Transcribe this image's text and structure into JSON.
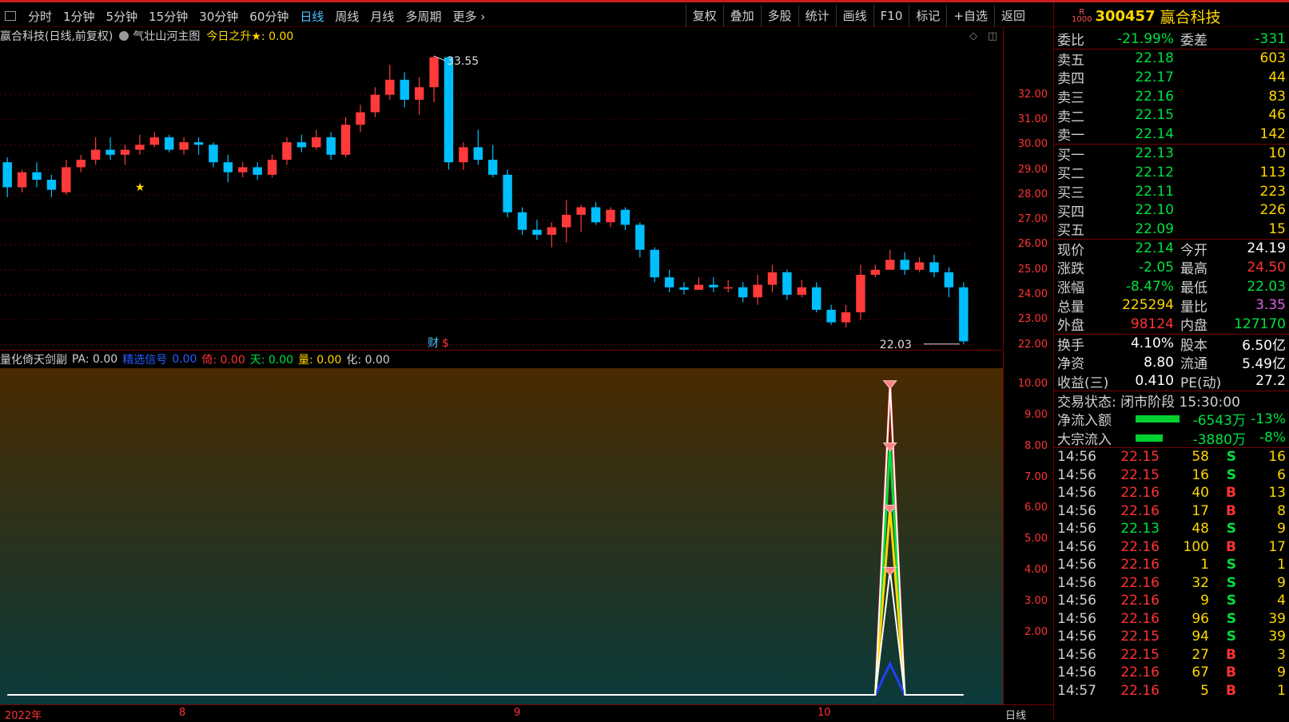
{
  "toolbar": {
    "periods": [
      "分时",
      "1分钟",
      "5分钟",
      "15分钟",
      "30分钟",
      "60分钟",
      "日线",
      "周线",
      "月线",
      "多周期",
      "更多 ›"
    ],
    "active": "日线",
    "tools": [
      "复权",
      "叠加",
      "多股",
      "统计",
      "画线",
      "F10",
      "标记",
      "+自选",
      "返回"
    ]
  },
  "stock": {
    "badge_top": "R",
    "badge_bottom": "1000",
    "code": "300457",
    "name": "赢合科技"
  },
  "main_chart": {
    "title_stock": "赢合科技(日线,前复权)",
    "indicator_name": "气壮山河主图",
    "indicator_value": "今日之升★: 0.00",
    "high_label": "33.55",
    "low_label": "22.03",
    "cai_label": "财",
    "dollar_label": "$",
    "y_ticks": [
      "32.00",
      "31.00",
      "30.00",
      "29.00",
      "28.00",
      "27.00",
      "26.00",
      "25.00",
      "24.00",
      "23.00",
      "22.00"
    ]
  },
  "sub_chart": {
    "name": "量化倚天剑副",
    "pa": "PA: 0.00",
    "sig_label": "精选信号",
    "sig_val": "0.00",
    "yi": "倚: 0.00",
    "tian": "天: 0.00",
    "liang": "量: 0.00",
    "hua": "化: 0.00",
    "y_ticks": [
      "10.00",
      "9.00",
      "8.00",
      "7.00",
      "6.00",
      "5.00",
      "4.00",
      "3.00",
      "2.00"
    ]
  },
  "x_axis": {
    "year": "2022年",
    "m8": "8",
    "m9": "9",
    "m10": "10",
    "period": "日线"
  },
  "quote": {
    "weibi": {
      "label": "委比",
      "value": "-21.99%",
      "label2": "委差",
      "value2": "-331"
    },
    "asks": [
      {
        "label": "卖五",
        "price": "22.18",
        "vol": "603"
      },
      {
        "label": "卖四",
        "price": "22.17",
        "vol": "44"
      },
      {
        "label": "卖三",
        "price": "22.16",
        "vol": "83"
      },
      {
        "label": "卖二",
        "price": "22.15",
        "vol": "46"
      },
      {
        "label": "卖一",
        "price": "22.14",
        "vol": "142"
      }
    ],
    "bids": [
      {
        "label": "买一",
        "price": "22.13",
        "vol": "10"
      },
      {
        "label": "买二",
        "price": "22.12",
        "vol": "113"
      },
      {
        "label": "买三",
        "price": "22.11",
        "vol": "223"
      },
      {
        "label": "买四",
        "price": "22.10",
        "vol": "226"
      },
      {
        "label": "买五",
        "price": "22.09",
        "vol": "15"
      }
    ],
    "stats": [
      {
        "l1": "现价",
        "v1": "22.14",
        "c1": "grn",
        "l2": "今开",
        "v2": "24.19",
        "c2": "wht"
      },
      {
        "l1": "涨跌",
        "v1": "-2.05",
        "c1": "grn",
        "l2": "最高",
        "v2": "24.50",
        "c2": "red"
      },
      {
        "l1": "涨幅",
        "v1": "-8.47%",
        "c1": "grn",
        "l2": "最低",
        "v2": "22.03",
        "c2": "grn"
      },
      {
        "l1": "总量",
        "v1": "225294",
        "c1": "yel",
        "l2": "量比",
        "v2": "3.35",
        "c2": "mag"
      },
      {
        "l1": "外盘",
        "v1": "98124",
        "c1": "red",
        "l2": "内盘",
        "v2": "127170",
        "c2": "grn"
      }
    ],
    "stats2": [
      {
        "l1": "换手",
        "v1": "4.10%",
        "l2": "股本",
        "v2": "6.50亿"
      },
      {
        "l1": "净资",
        "v1": "8.80",
        "l2": "流通",
        "v2": "5.49亿"
      },
      {
        "l1": "收益(三)",
        "v1": "0.410",
        "l2": "PE(动)",
        "v2": "27.2"
      }
    ],
    "trade_status": "交易状态: 闭市阶段 15:30:00",
    "net_inflow": {
      "label": "净流入额",
      "value": "-6543万",
      "pct": "-13%",
      "bar": 0.13
    },
    "block_inflow": {
      "label": "大宗流入",
      "value": "-3880万",
      "pct": "-8%",
      "bar": 0.08
    }
  },
  "ticks": [
    {
      "t": "14:56",
      "p": "22.15",
      "v": "58",
      "bs": "S",
      "n": "16"
    },
    {
      "t": "14:56",
      "p": "22.15",
      "v": "16",
      "bs": "S",
      "n": "6"
    },
    {
      "t": "14:56",
      "p": "22.16",
      "v": "40",
      "bs": "B",
      "n": "13"
    },
    {
      "t": "14:56",
      "p": "22.16",
      "v": "17",
      "bs": "B",
      "n": "8"
    },
    {
      "t": "14:56",
      "p": "22.13",
      "v": "48",
      "bs": "S",
      "n": "9"
    },
    {
      "t": "14:56",
      "p": "22.16",
      "v": "100",
      "bs": "B",
      "n": "17"
    },
    {
      "t": "14:56",
      "p": "22.16",
      "v": "1",
      "bs": "S",
      "n": "1"
    },
    {
      "t": "14:56",
      "p": "22.16",
      "v": "32",
      "bs": "S",
      "n": "9"
    },
    {
      "t": "14:56",
      "p": "22.16",
      "v": "9",
      "bs": "S",
      "n": "4"
    },
    {
      "t": "14:56",
      "p": "22.16",
      "v": "96",
      "bs": "S",
      "n": "39"
    },
    {
      "t": "14:56",
      "p": "22.15",
      "v": "94",
      "bs": "S",
      "n": "39"
    },
    {
      "t": "14:56",
      "p": "22.15",
      "v": "27",
      "bs": "B",
      "n": "3"
    },
    {
      "t": "14:56",
      "p": "22.16",
      "v": "67",
      "bs": "B",
      "n": "9"
    },
    {
      "t": "14:57",
      "p": "22.16",
      "v": "5",
      "bs": "B",
      "n": "1"
    }
  ],
  "candles": [
    [
      29.3,
      28.3,
      29.5,
      27.9
    ],
    [
      28.3,
      28.9,
      29.0,
      28.1
    ],
    [
      28.9,
      28.6,
      29.3,
      28.3
    ],
    [
      28.6,
      28.2,
      28.8,
      27.9
    ],
    [
      28.1,
      29.1,
      29.4,
      28.0
    ],
    [
      29.1,
      29.4,
      29.6,
      28.9
    ],
    [
      29.4,
      29.8,
      30.3,
      29.2
    ],
    [
      29.8,
      29.6,
      30.3,
      29.4
    ],
    [
      29.6,
      29.8,
      30.0,
      29.2
    ],
    [
      29.8,
      30.0,
      30.4,
      29.6
    ],
    [
      30.0,
      30.3,
      30.5,
      29.9
    ],
    [
      30.3,
      29.8,
      30.4,
      29.7
    ],
    [
      29.8,
      30.1,
      30.3,
      29.6
    ],
    [
      30.1,
      30.0,
      30.3,
      29.6
    ],
    [
      30.0,
      29.3,
      30.1,
      29.1
    ],
    [
      29.3,
      28.9,
      29.6,
      28.5
    ],
    [
      28.9,
      29.1,
      29.3,
      28.7
    ],
    [
      29.1,
      28.8,
      29.3,
      28.6
    ],
    [
      28.8,
      29.4,
      29.6,
      28.7
    ],
    [
      29.4,
      30.1,
      30.3,
      29.2
    ],
    [
      30.1,
      29.9,
      30.4,
      29.7
    ],
    [
      29.9,
      30.3,
      30.6,
      29.8
    ],
    [
      30.3,
      29.6,
      30.5,
      29.4
    ],
    [
      29.6,
      30.8,
      31.1,
      29.5
    ],
    [
      30.8,
      31.3,
      31.6,
      30.5
    ],
    [
      31.3,
      32.0,
      32.3,
      31.1
    ],
    [
      32.0,
      32.6,
      33.2,
      31.8
    ],
    [
      32.6,
      31.8,
      32.9,
      31.5
    ],
    [
      31.8,
      32.3,
      32.7,
      31.2
    ],
    [
      32.3,
      33.5,
      33.55,
      31.7
    ],
    [
      33.5,
      29.3,
      33.4,
      29.0
    ],
    [
      29.3,
      29.9,
      30.1,
      29.0
    ],
    [
      29.9,
      29.4,
      30.6,
      29.2
    ],
    [
      29.4,
      28.8,
      30.0,
      28.7
    ],
    [
      28.8,
      27.3,
      29.0,
      27.1
    ],
    [
      27.3,
      26.6,
      27.5,
      26.4
    ],
    [
      26.6,
      26.4,
      27.0,
      26.2
    ],
    [
      26.4,
      26.7,
      26.9,
      25.9
    ],
    [
      26.7,
      27.2,
      27.8,
      26.1
    ],
    [
      27.2,
      27.5,
      27.6,
      26.5
    ],
    [
      27.5,
      26.9,
      27.7,
      26.8
    ],
    [
      26.9,
      27.4,
      27.5,
      26.7
    ],
    [
      27.4,
      26.8,
      27.5,
      26.6
    ],
    [
      26.8,
      25.8,
      26.9,
      25.5
    ],
    [
      25.8,
      24.7,
      25.9,
      24.5
    ],
    [
      24.7,
      24.3,
      25.0,
      24.1
    ],
    [
      24.3,
      24.2,
      24.5,
      24.0
    ],
    [
      24.2,
      24.4,
      24.7,
      24.2
    ],
    [
      24.4,
      24.3,
      24.7,
      24.1
    ],
    [
      24.3,
      24.3,
      24.6,
      24.1
    ],
    [
      24.3,
      23.9,
      24.5,
      23.7
    ],
    [
      23.9,
      24.4,
      24.8,
      23.6
    ],
    [
      24.4,
      24.9,
      25.2,
      24.1
    ],
    [
      24.9,
      24.0,
      25.0,
      23.8
    ],
    [
      24.0,
      24.3,
      24.6,
      23.9
    ],
    [
      24.3,
      23.4,
      24.5,
      23.3
    ],
    [
      23.4,
      22.9,
      23.6,
      22.8
    ],
    [
      22.9,
      23.3,
      23.6,
      22.7
    ],
    [
      23.3,
      24.8,
      25.2,
      23.0
    ],
    [
      24.8,
      25.0,
      25.2,
      24.7
    ],
    [
      25.0,
      25.4,
      25.8,
      25.0
    ],
    [
      25.4,
      25.0,
      25.7,
      24.8
    ],
    [
      25.0,
      25.3,
      25.5,
      24.9
    ],
    [
      25.3,
      24.9,
      25.6,
      24.7
    ],
    [
      24.9,
      24.3,
      25.1,
      23.9
    ],
    [
      24.3,
      22.14,
      24.5,
      22.03
    ]
  ],
  "signal": [
    0,
    0,
    0,
    0,
    0,
    0,
    0,
    0,
    0,
    0,
    0,
    0,
    0,
    0,
    0,
    0,
    0,
    0,
    0,
    0,
    0,
    0,
    0,
    0,
    0,
    0,
    0,
    0,
    0,
    0,
    0,
    0,
    0,
    0,
    0,
    0,
    0,
    0,
    0,
    0,
    0,
    0,
    0,
    0,
    0,
    0,
    0,
    0,
    0,
    0,
    0,
    0,
    0,
    0,
    0,
    0,
    0,
    0,
    0,
    0,
    10,
    0,
    0,
    0,
    0,
    0
  ]
}
